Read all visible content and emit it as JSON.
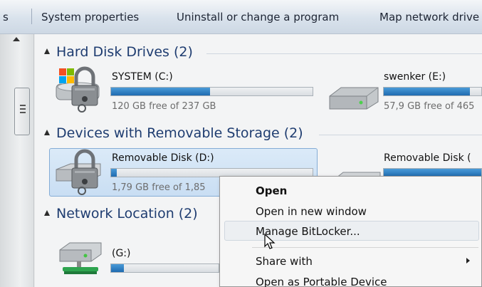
{
  "toolbar": {
    "partial_left": "s",
    "items": [
      "System properties",
      "Uninstall or change a program",
      "Map network drive"
    ]
  },
  "groups": {
    "hard_disks": {
      "title": "Hard Disk Drives (2)",
      "drives": [
        {
          "name": "SYSTEM (C:)",
          "free": "120 GB free of 237 GB",
          "used_fraction": 0.49,
          "icon": "bitlocker-lock-drive-icon"
        },
        {
          "name": "swenker (E:)",
          "free": "57,9 GB free of 465",
          "used_fraction": 0.88,
          "icon": "hard-drive-icon"
        }
      ]
    },
    "removable": {
      "title": "Devices with Removable Storage (2)",
      "drives": [
        {
          "name": "Removable Disk (D:)",
          "free": "1,79 GB free of 1,85",
          "used_fraction": 0.03,
          "icon": "bitlocker-lock-usb-icon"
        },
        {
          "name": "Removable Disk (",
          "free": "",
          "used_fraction": 1.0,
          "icon": "removable-drive-icon"
        }
      ]
    },
    "network": {
      "title": "Network Location (2)",
      "drives": [
        {
          "name": "(G:)",
          "free": "",
          "used_fraction": 0.12,
          "icon": "network-drive-icon"
        }
      ]
    }
  },
  "context_menu": {
    "items": [
      "Open",
      "Open in new window",
      "Manage BitLocker...",
      "Share with",
      "Open as Portable Device"
    ],
    "hovered": "Manage BitLocker..."
  },
  "colors": {
    "accent_blue": "#1f6bb0",
    "group_title": "#1e3c70",
    "selection": "#c9def3"
  }
}
